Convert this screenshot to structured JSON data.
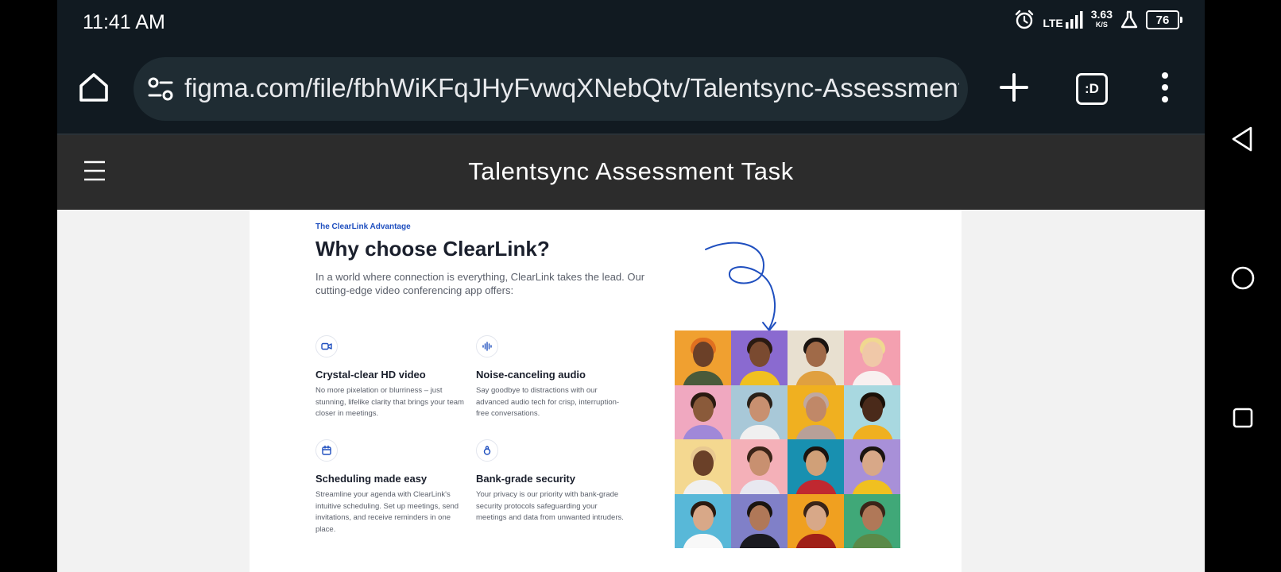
{
  "status_bar": {
    "time": "11:41 AM",
    "network": "LTE",
    "speed": "3.63",
    "speed_unit": "K/S",
    "battery": "76"
  },
  "browser": {
    "url": "figma.com/file/fbhWiKFqJHyFvwqXNebQtv/Talentsync-Assessment",
    "tab_switcher": ":D"
  },
  "figma": {
    "title": "Talentsync Assessment Task"
  },
  "design": {
    "eyebrow": "The ClearLink Advantage",
    "headline": "Why choose ClearLink?",
    "intro": "In a world where connection is everything, ClearLink takes the lead. Our cutting-edge video conferencing app offers:",
    "accent": "#1f4fbf",
    "features": [
      {
        "icon": "video-icon",
        "title": "Crystal-clear HD video",
        "description": "No more pixelation or blurriness – just stunning, lifelike clarity that brings your team closer in meetings."
      },
      {
        "icon": "audio-wave-icon",
        "title": "Noise-canceling audio",
        "description": "Say goodbye to distractions with our advanced audio tech for crisp, interruption-free conversations."
      },
      {
        "icon": "calendar-icon",
        "title": "Scheduling made easy",
        "description": "Streamline your agenda with ClearLink's intuitive scheduling. Set up meetings, send invitations, and receive reminders in one place."
      },
      {
        "icon": "lock-icon",
        "title": "Bank-grade security",
        "description": "Your privacy is our priority with bank-grade security protocols safeguarding your meetings and data from unwanted intruders."
      }
    ],
    "portraits": [
      {
        "bg": "#f0a030",
        "skin": "#6b4028",
        "hair": "#e07020",
        "shirt": "#4a5a3a"
      },
      {
        "bg": "#8a6ad0",
        "skin": "#7a4a30",
        "hair": "#2a1a12",
        "shirt": "#f0c020"
      },
      {
        "bg": "#e8e0d0",
        "skin": "#a06a48",
        "hair": "#1a1410",
        "shirt": "#e0a040"
      },
      {
        "bg": "#f4a0b0",
        "skin": "#f0c8a8",
        "hair": "#f0d890",
        "shirt": "#f8f0f0"
      },
      {
        "bg": "#f0a8c0",
        "skin": "#8a5a3a",
        "hair": "#2a1a10",
        "shirt": "#a088d8"
      },
      {
        "bg": "#a8c8d8",
        "skin": "#c89070",
        "hair": "#2a2018",
        "shirt": "#f0f0f0"
      },
      {
        "bg": "#f0b020",
        "skin": "#c08868",
        "hair": "#c0a8a0",
        "shirt": "#b8a098"
      },
      {
        "bg": "#a8d8e0",
        "skin": "#4a2a1a",
        "hair": "#1a1008",
        "shirt": "#f0b020"
      },
      {
        "bg": "#f4d890",
        "skin": "#6a4028",
        "hair": "#e8c890",
        "shirt": "#f0f0f0"
      },
      {
        "bg": "#f4b0b8",
        "skin": "#c89070",
        "hair": "#3a2418",
        "shirt": "#e8e8f0"
      },
      {
        "bg": "#1890b0",
        "skin": "#d0a078",
        "hair": "#1a1410",
        "shirt": "#c02830"
      },
      {
        "bg": "#a890d8",
        "skin": "#d8a888",
        "hair": "#1a1410",
        "shirt": "#f0c020"
      },
      {
        "bg": "#58b8d8",
        "skin": "#d8a888",
        "hair": "#2a1a10",
        "shirt": "#f8f8f8"
      },
      {
        "bg": "#8080c8",
        "skin": "#b07858",
        "hair": "#1a1410",
        "shirt": "#1a1a20"
      },
      {
        "bg": "#f0a020",
        "skin": "#d8a888",
        "hair": "#3a2418",
        "shirt": "#a02018"
      },
      {
        "bg": "#40a878",
        "skin": "#b07858",
        "hair": "#3a2418",
        "shirt": "#5a8a48"
      }
    ]
  }
}
